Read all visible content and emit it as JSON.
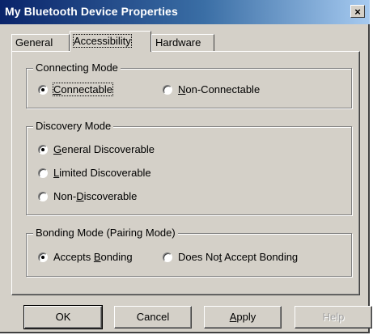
{
  "window": {
    "title": "My Bluetooth Device Properties",
    "close_label": "×"
  },
  "tabs": [
    {
      "label": "General",
      "active": false
    },
    {
      "label": "Accessibility",
      "active": true
    },
    {
      "label": "Hardware",
      "active": false
    }
  ],
  "connecting_mode": {
    "label": "Connecting Mode",
    "options": [
      {
        "label": "Connectable",
        "checked": true
      },
      {
        "label": "Non-Connectable",
        "checked": false
      }
    ]
  },
  "discovery_mode": {
    "label": "Discovery Mode",
    "options": [
      {
        "label": "General Discoverable",
        "checked": true
      },
      {
        "label": "Limited Discoverable",
        "checked": false
      },
      {
        "label": "Non-Discoverable",
        "checked": false
      }
    ]
  },
  "bonding_mode": {
    "label": "Bonding Mode (Pairing Mode)",
    "options": [
      {
        "label": "Accepts Bonding",
        "checked": true
      },
      {
        "label": "Does Not Accept Bonding",
        "checked": false
      }
    ]
  },
  "buttons": {
    "ok": "OK",
    "cancel": "Cancel",
    "apply": "Apply",
    "help": "Help"
  },
  "colors": {
    "title_bar_start": "#0a246a",
    "title_bar_end": "#a6caf0",
    "dialog_face": "#d4d0c8"
  }
}
